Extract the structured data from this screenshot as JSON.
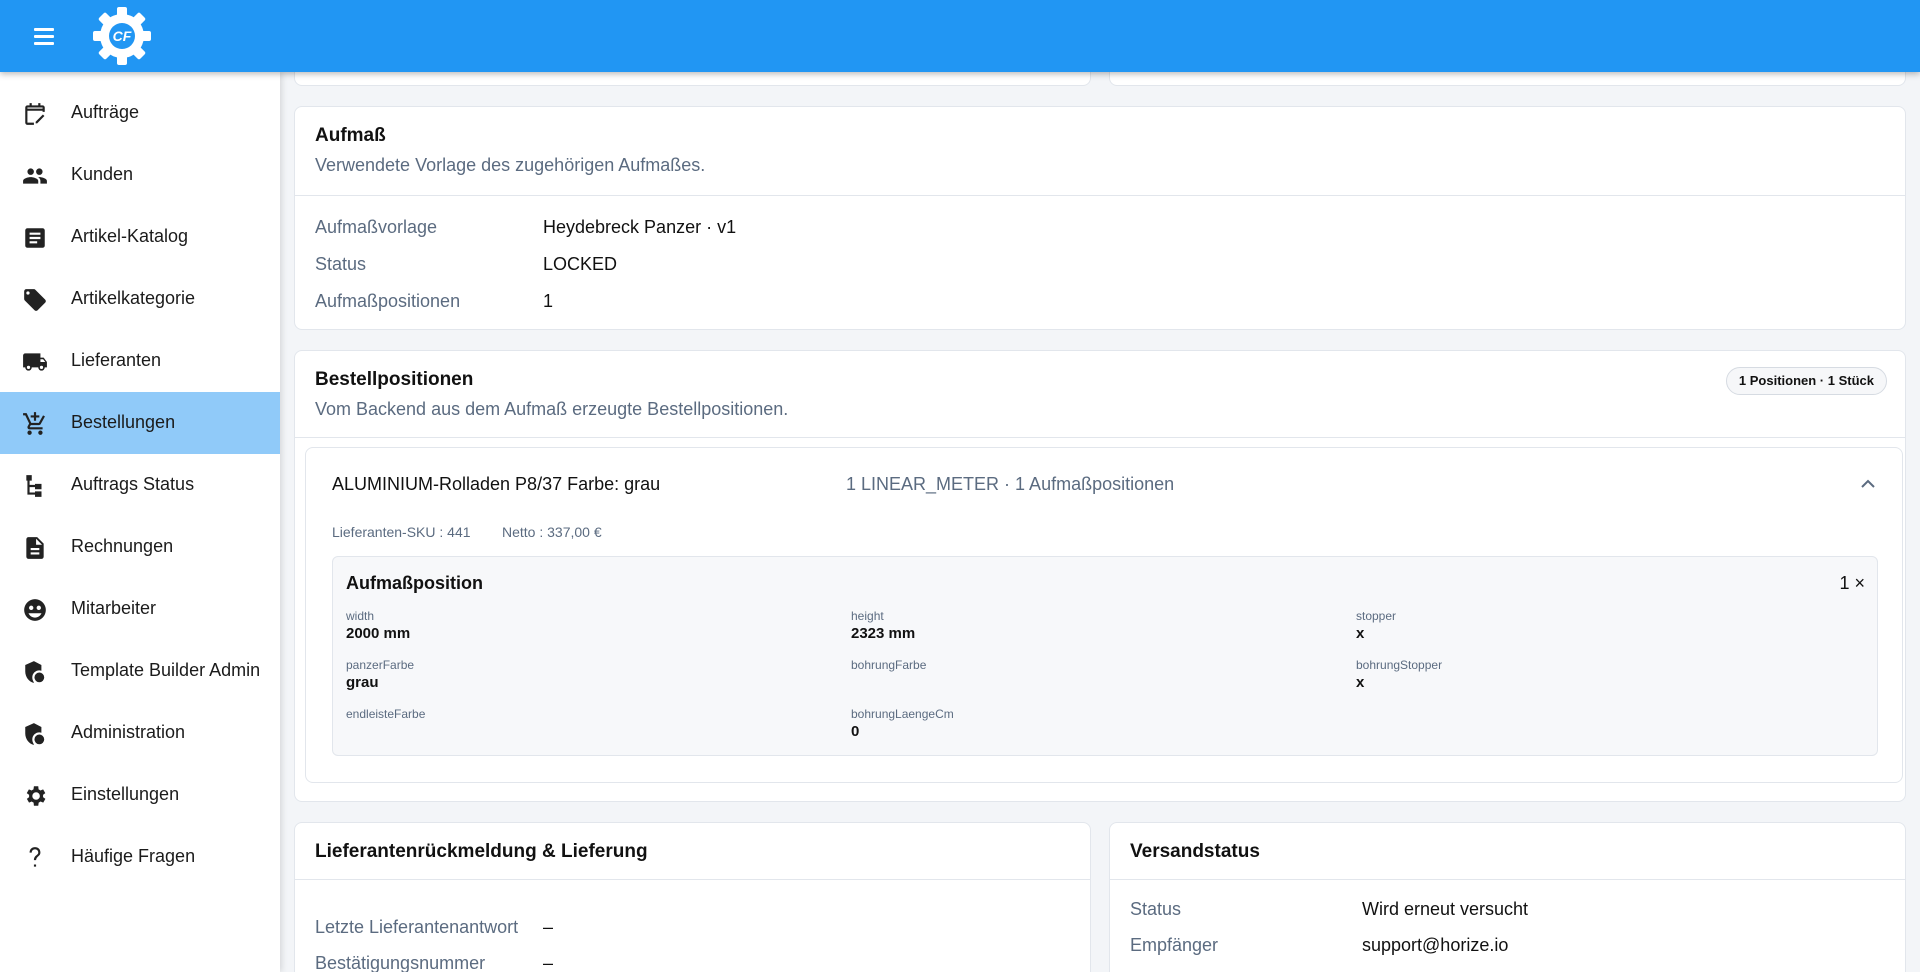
{
  "topbar": {
    "logo_text": "CF",
    "brand_color": "#2196f3"
  },
  "sidebar": {
    "active_color": "#90caf9",
    "items": [
      {
        "label": "Aufträge",
        "icon": "calendar-edit-icon"
      },
      {
        "label": "Kunden",
        "icon": "people-icon"
      },
      {
        "label": "Artikel-Katalog",
        "icon": "article-icon"
      },
      {
        "label": "Artikelkategorie",
        "icon": "tag-icon"
      },
      {
        "label": "Lieferanten",
        "icon": "truck-icon"
      },
      {
        "label": "Bestellungen",
        "icon": "cart-add-icon"
      },
      {
        "label": "Auftrags Status",
        "icon": "tree-status-icon"
      },
      {
        "label": "Rechnungen",
        "icon": "document-icon"
      },
      {
        "label": "Mitarbeiter",
        "icon": "face-icon"
      },
      {
        "label": "Template Builder Admin",
        "icon": "admin-shield-icon"
      },
      {
        "label": "Administration",
        "icon": "admin-shield-icon"
      },
      {
        "label": "Einstellungen",
        "icon": "gear-icon"
      },
      {
        "label": "Häufige Fragen",
        "icon": "question-icon"
      }
    ]
  },
  "aufmass": {
    "title": "Aufmaß",
    "subtitle": "Verwendete Vorlage des zugehörigen Aufmaßes.",
    "rows": [
      {
        "label": "Aufmaßvorlage",
        "value": "Heydebreck Panzer · v1"
      },
      {
        "label": "Status",
        "value": "LOCKED"
      },
      {
        "label": "Aufmaßpositionen",
        "value": "1"
      }
    ]
  },
  "bestellpositionen": {
    "title": "Bestellpositionen",
    "subtitle": "Vom Backend aus dem Aufmaß erzeugte Bestellpositionen.",
    "badge": "1 Positionen · 1 Stück",
    "position": {
      "name": "ALUMINIUM-Rolladen P8/37 Farbe: grau",
      "meta": "1 LINEAR_METER · 1 Aufmaßpositionen",
      "sku": "Lieferanten-SKU : 441",
      "netto": "Netto : 337,00 €",
      "measurement": {
        "title": "Aufmaßposition",
        "count": "1 ×",
        "fields": [
          {
            "label": "width",
            "value": "2000 mm"
          },
          {
            "label": "height",
            "value": "2323 mm"
          },
          {
            "label": "stopper",
            "value": "x"
          },
          {
            "label": "panzerFarbe",
            "value": "grau"
          },
          {
            "label": "bohrungFarbe",
            "value": ""
          },
          {
            "label": "bohrungStopper",
            "value": "x"
          },
          {
            "label": "endleisteFarbe",
            "value": ""
          },
          {
            "label": "bohrungLaengeCm",
            "value": "0"
          }
        ]
      }
    }
  },
  "lieferanten": {
    "title": "Lieferantenrückmeldung & Lieferung",
    "rows": [
      {
        "label": "Letzte Lieferantenantwort",
        "value": "–"
      },
      {
        "label": "Bestätigungsnummer",
        "value": "–"
      }
    ]
  },
  "versand": {
    "title": "Versandstatus",
    "rows": [
      {
        "label": "Status",
        "value": "Wird erneut versucht"
      },
      {
        "label": "Empfänger",
        "value": "support@horize.io"
      }
    ]
  }
}
